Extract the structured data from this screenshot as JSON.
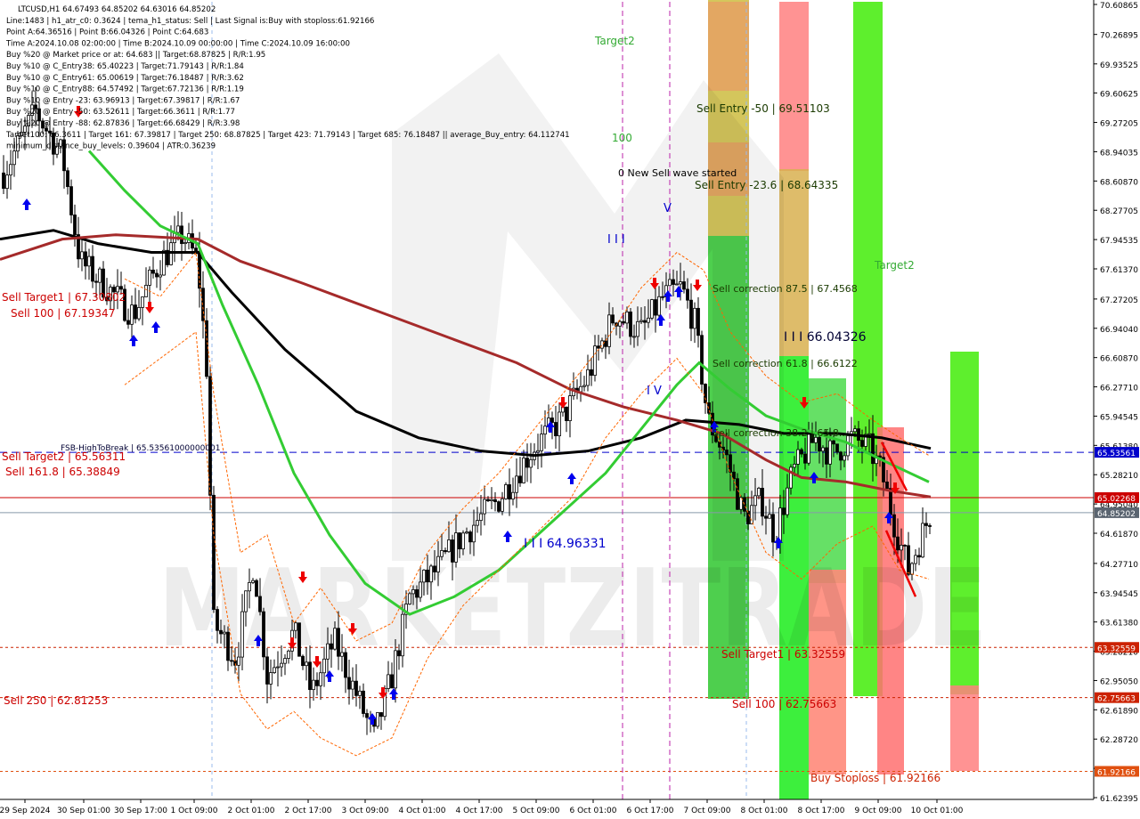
{
  "info_lines": [
    "LTCUSD,H1  64.67493 64.85202 64.63016 64.85202",
    "Line:1483 | h1_atr_c0: 0.3624 | tema_h1_status: Sell | Last Signal is:Buy with stoploss:61.92166",
    "Point A:64.36516 | Point B:66.04326 | Point C:64.683",
    "Time A:2024.10.08 02:00:00 | Time B:2024.10.09 00:00:00 | Time C:2024.10.09 16:00:00",
    "Buy %20 @ Market price or at: 64.683 || Target:68.87825 | R/R:1.95",
    "Buy %10 @ C_Entry38: 65.40223 | Target:71.79143 | R/R:1.84",
    "Buy %10 @ C_Entry61: 65.00619 | Target:76.18487 | R/R:3.62",
    "Buy %10 @ C_Entry88: 64.57492 | Target:67.72136 | R/R:1.19",
    "Buy %10 @ Entry -23: 63.96913 | Target:67.39817 | R/R:1.67",
    "Buy %20 @ Entry -50: 63.52611 | Target:66.3611 | R/R:1.77",
    "Buy %20 @ Entry -88: 62.87836 | Target:66.68429 | R/R:3.98",
    "Target100: 66.3611 | Target 161: 67.39817 | Target 250: 68.87825 | Target 423: 71.79143 | Target 685: 76.18487 || average_Buy_entry: 64.112741",
    "minimum_distance_buy_levels: 0.39604 | ATR:0.36239"
  ],
  "price_axis": {
    "ticks": [
      "70.60865",
      "70.26895",
      "69.93525",
      "69.60625",
      "69.27205",
      "68.94035",
      "68.60870",
      "68.27705",
      "67.94535",
      "67.61370",
      "67.27205",
      "66.94040",
      "66.60870",
      "66.27710",
      "65.94545",
      "65.61380",
      "65.28210",
      "64.95040",
      "64.61870",
      "64.27710",
      "63.94545",
      "63.61380",
      "63.28210",
      "62.95050",
      "62.61890",
      "62.28720",
      "61.95550",
      "61.62395"
    ],
    "tick_values": [
      70.60865,
      70.26895,
      69.93525,
      69.60625,
      69.27205,
      68.94035,
      68.6087,
      68.27705,
      67.94535,
      67.6137,
      67.27205,
      66.9404,
      66.6087,
      66.2771,
      65.94545,
      65.6138,
      65.2821,
      64.9504,
      64.6187,
      64.2771,
      63.94545,
      63.6138,
      63.2821,
      62.9505,
      62.6189,
      62.2872,
      61.9555,
      61.62395
    ],
    "badges": [
      {
        "label": "65.53561",
        "value": 65.53561,
        "color": "#0000cc",
        "text_color": "#ffffff"
      },
      {
        "label": "65.02268",
        "value": 65.02268,
        "color": "#cc0000",
        "text_color": "#ffffff"
      },
      {
        "label": "64.85202",
        "value": 64.85202,
        "color": "#5a6470",
        "text_color": "#ffffff"
      },
      {
        "label": "63.32559",
        "value": 63.32559,
        "color": "#cc2200",
        "text_color": "#ffffff"
      },
      {
        "label": "62.75663",
        "value": 62.75663,
        "color": "#cc2200",
        "text_color": "#ffffff"
      },
      {
        "label": "61.92166",
        "value": 61.92166,
        "color": "#e05010",
        "text_color": "#ffffff"
      }
    ]
  },
  "time_axis": [
    "29 Sep 2024",
    "30 Sep 01:00",
    "30 Sep 17:00",
    "1 Oct 09:00",
    "2 Oct 01:00",
    "2 Oct 17:00",
    "3 Oct 09:00",
    "4 Oct 01:00",
    "4 Oct 17:00",
    "5 Oct 09:00",
    "6 Oct 01:00",
    "6 Oct 17:00",
    "7 Oct 09:00",
    "8 Oct 01:00",
    "8 Oct 17:00",
    "9 Oct 09:00",
    "10 Oct 01:00"
  ],
  "level_labels": {
    "sell_target1_left": "Sell Target1 | 67.30802",
    "sell_100_left": "Sell 100 | 67.19347",
    "fsb_high": "FSB-HighToBreak | 65.53561000000001",
    "sell_target2": "Sell Target2 | 65.56311",
    "sell_161": "Sell 161.8 | 65.38849",
    "sell_250": "Sell 250 | 62.81253",
    "target2_top": "Target2",
    "label_100": "100",
    "new_sell_wave": "0 New Sell wave started",
    "sell_entry_50": "Sell Entry -50 | 69.51103",
    "sell_entry_23": "Sell Entry -23.6 | 68.64335",
    "sell_corr_875": "Sell correction 87.5 | 67.4568",
    "point_b": "I I I  66.04326",
    "sell_corr_618": "Sell correction 61.8 | 66.6122",
    "sell_corr_382": "Sell correction 38.2 | 65.8...",
    "point_c_low": "I I I  64.96331",
    "sell_target1": "Sell Target1 | 63.32559",
    "sell_100": "Sell 100 | 62.75663",
    "buy_stoploss": "Buy Stoploss | 61.92166",
    "target2_right": "Target2",
    "wave_v": "V",
    "wave_iii": "I I I",
    "wave_iv": "I V"
  },
  "watermark": "MARKETZITRADE",
  "colors": {
    "ma_black": "#000000",
    "ma_darkred": "#a52a2a",
    "ma_green": "#33cc33",
    "sell_zone": "#ff6e6e",
    "buy_zone": "#33dd33",
    "hline_blue": "#0000cc",
    "hline_red": "#cc0000"
  }
}
